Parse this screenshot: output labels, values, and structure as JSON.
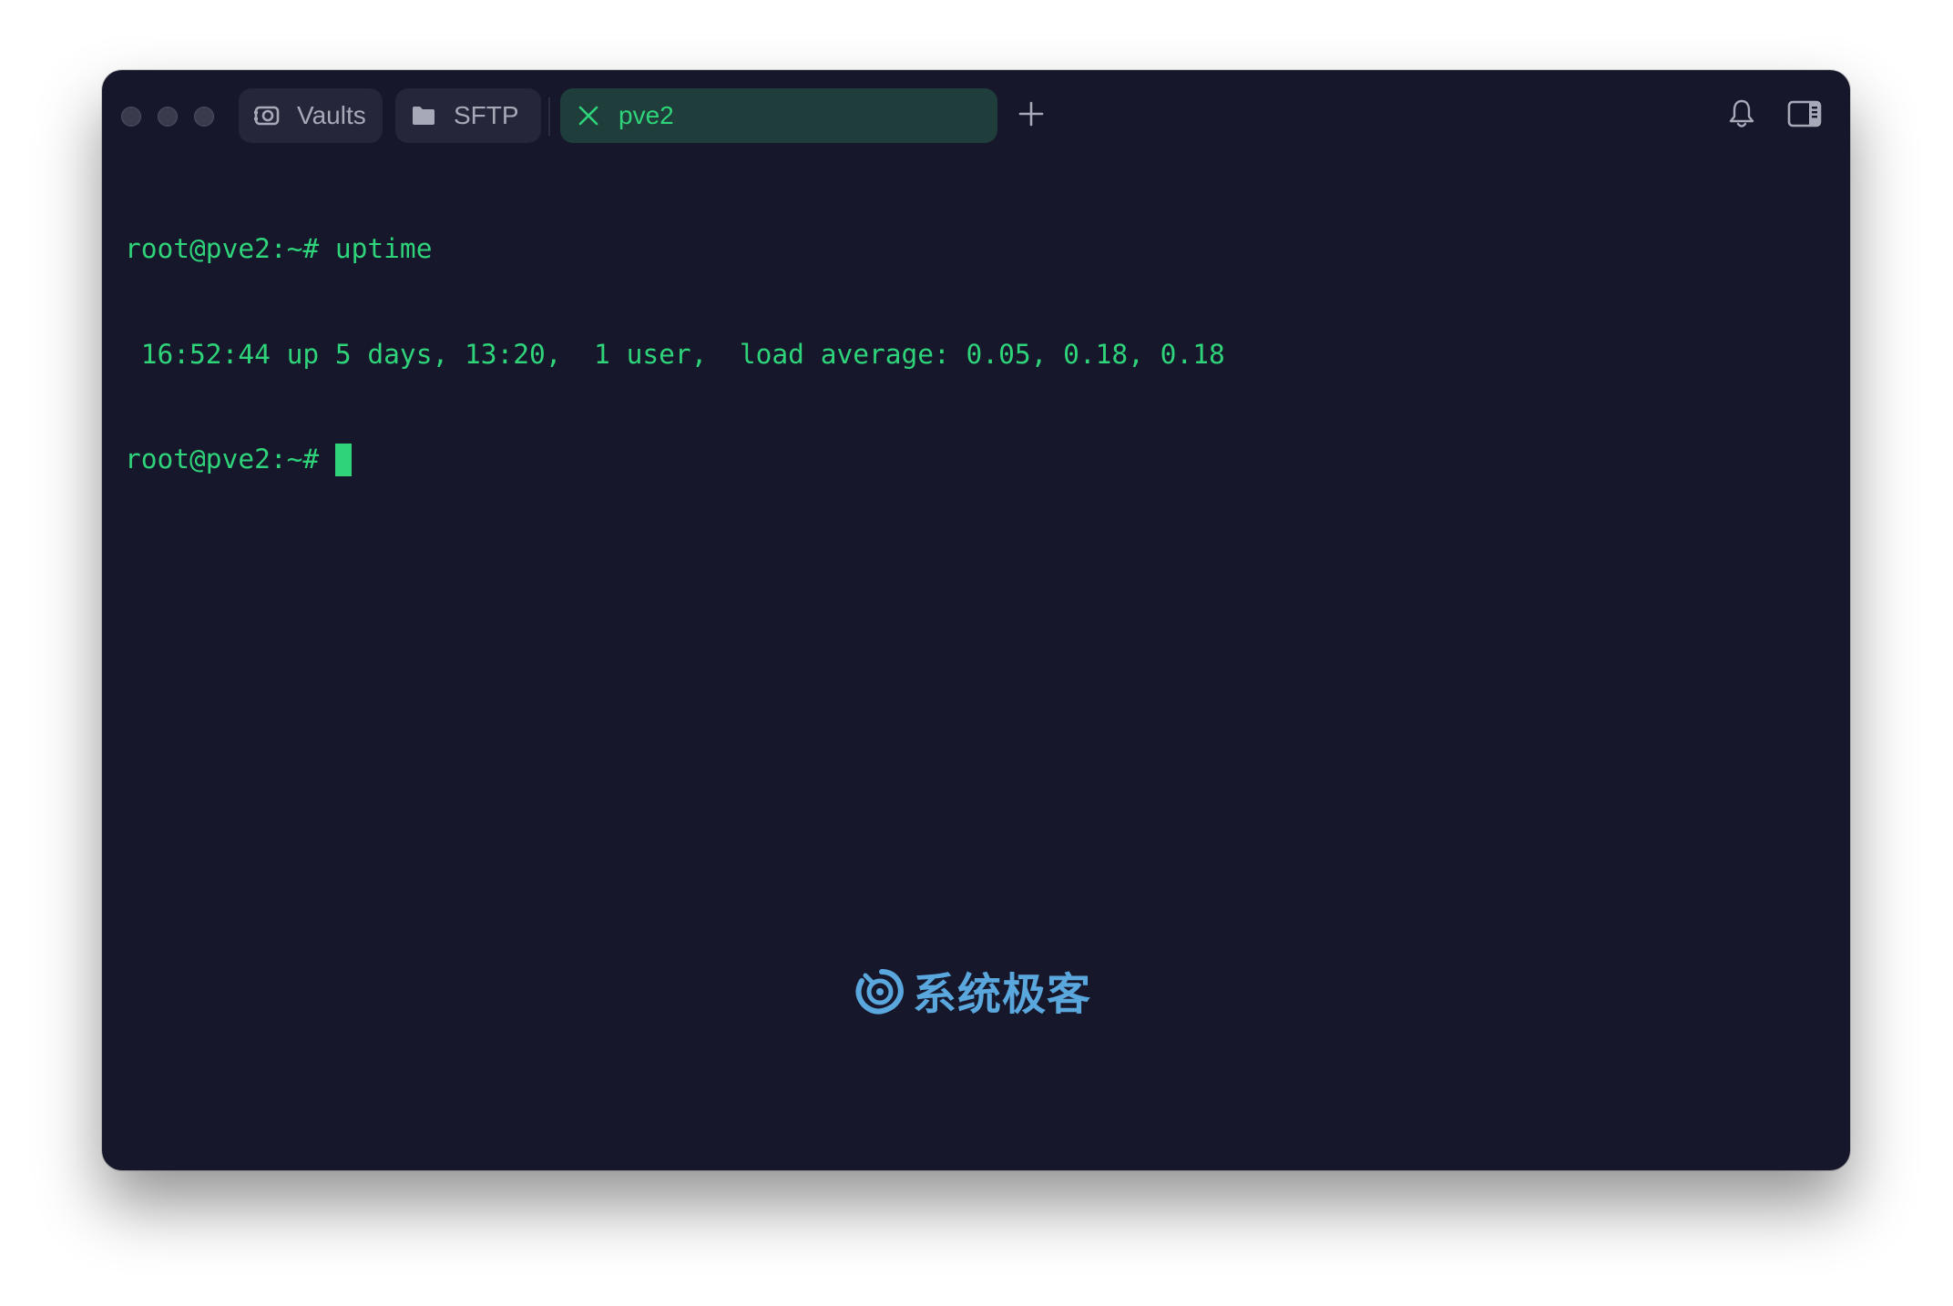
{
  "window": {
    "traffic_lights": [
      "close",
      "minimize",
      "zoom"
    ]
  },
  "tabs": [
    {
      "label": "Vaults",
      "icon": "vault-icon",
      "active": false
    },
    {
      "label": "SFTP",
      "icon": "folder-icon",
      "active": false
    },
    {
      "label": "pve2",
      "icon": "close-icon",
      "active": true
    }
  ],
  "toolbar": {
    "new_tab_icon": "plus-icon",
    "notifications_icon": "bell-icon",
    "sidebar_icon": "sidebar-toggle-icon"
  },
  "terminal": {
    "lines": [
      "root@pve2:~# uptime",
      " 16:52:44 up 5 days, 13:20,  1 user,  load average: 0.05, 0.18, 0.18",
      "root@pve2:~# "
    ]
  },
  "watermark": {
    "text": "系统极客"
  },
  "colors": {
    "terminal_bg": "#16172b",
    "terminal_fg": "#2fd47a",
    "active_tab_bg": "#1f3d3a",
    "tab_bg": "#25263a",
    "watermark": "#5aa7de"
  }
}
